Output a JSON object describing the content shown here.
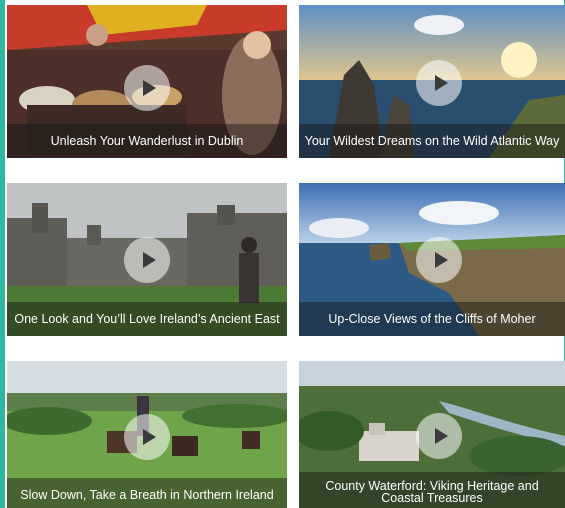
{
  "videos": [
    {
      "title": "Unleash Your Wanderlust in Dublin"
    },
    {
      "title": "Your Wildest Dreams on the Wild Atlantic Way"
    },
    {
      "title": "One Look and You’ll Love Ireland’s Ancient East"
    },
    {
      "title": "Up-Close Views of the Cliffs of Moher"
    },
    {
      "title": "Slow Down, Take a Breath in Northern Ireland"
    },
    {
      "title": "County Waterford: Viking Heritage and Coastal Treasures"
    }
  ],
  "icons": {
    "play": "play-icon"
  },
  "colors": {
    "accent": "#2fb8a0",
    "caption_bg": "rgba(20,20,20,0.45)"
  }
}
